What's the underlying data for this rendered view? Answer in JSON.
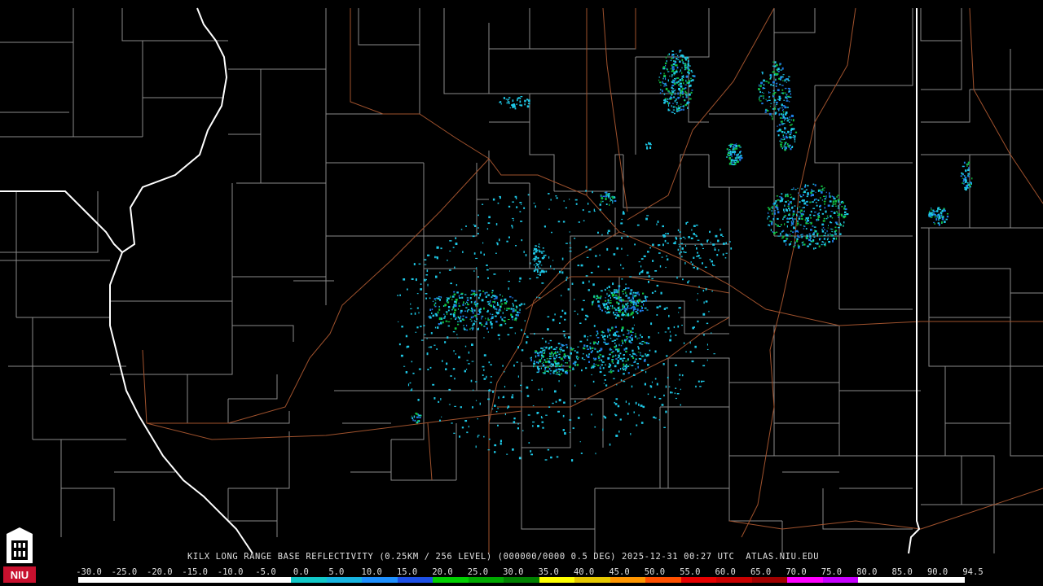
{
  "title": "KILX LONG RANGE BASE REFLECTIVITY (0.25KM / 256 LEVEL) (000000/0000 0.5 DEG) 2025-12-31 00:27 UTC  ATLAS.NIU.EDU",
  "logo_text": "NIU",
  "scale": {
    "labels": [
      "-30.0",
      "-25.0",
      "-20.0",
      "-15.0",
      "-10.0",
      "-5.0",
      "0.0",
      "5.0",
      "10.0",
      "15.0",
      "20.0",
      "25.0",
      "30.0",
      "35.0",
      "40.0",
      "45.0",
      "50.0",
      "55.0",
      "60.0",
      "65.0",
      "70.0",
      "75.0",
      "80.0",
      "85.0",
      "90.0",
      "94.5"
    ],
    "colors": [
      "#ffffff",
      "#ffffff",
      "#ffffff",
      "#ffffff",
      "#ffffff",
      "#ffffff",
      "#12c8c8",
      "#18b4e0",
      "#1e90ff",
      "#1e50e6",
      "#00d000",
      "#00a800",
      "#008000",
      "#ffff00",
      "#e6c800",
      "#ff9600",
      "#ff5000",
      "#e60000",
      "#c80000",
      "#a00000",
      "#ff00ff",
      "#c800ff",
      "#ffffff",
      "#ffffff",
      "#ffffff"
    ]
  },
  "colors": {
    "background": "#000000",
    "county_lines": "#8a8a8a",
    "state_lines": "#ffffff",
    "highways": "#a0522d",
    "echo_light": "#1ec8e6",
    "echo_medium": "#1e7ce6",
    "echo_heavy": "#10c040"
  }
}
